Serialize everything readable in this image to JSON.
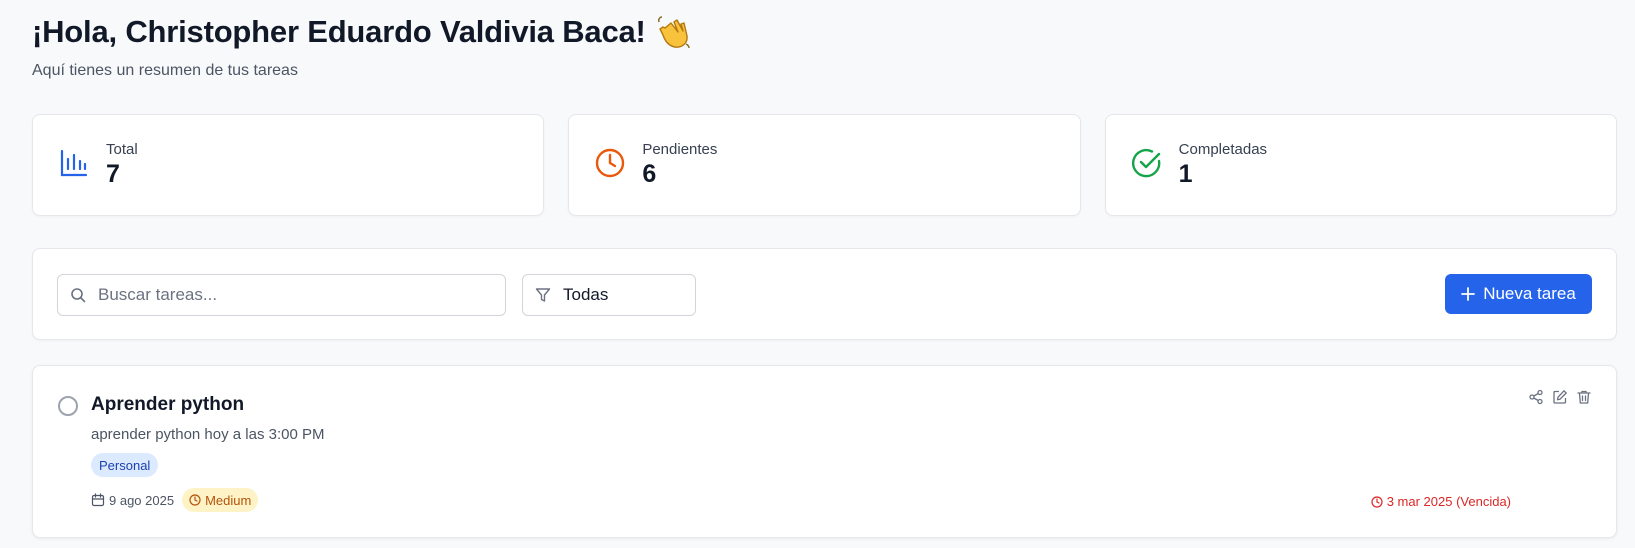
{
  "header": {
    "greeting": "¡Hola, Christopher Eduardo Valdivia Baca!",
    "wave_icon": "waving-hand-emoji",
    "subtitle": "Aquí tienes un resumen de tus tareas"
  },
  "stats": [
    {
      "label": "Total",
      "value": "7",
      "icon": "bar-chart-icon",
      "color": "#2563eb"
    },
    {
      "label": "Pendientes",
      "value": "6",
      "icon": "clock-icon",
      "color": "#ea580c"
    },
    {
      "label": "Completadas",
      "value": "1",
      "icon": "check-circle-icon",
      "color": "#16a34a"
    }
  ],
  "toolbar": {
    "search_placeholder": "Buscar tareas...",
    "filter_value": "Todas",
    "new_task_label": "Nueva tarea",
    "accent": "#2563eb"
  },
  "tasks": [
    {
      "title": "Aprender python",
      "description": "aprender python hoy a las 3:00 PM",
      "category": "Personal",
      "created": "9 ago 2025",
      "priority": "Medium",
      "due": "3 mar 2025 (Vencida)",
      "completed": false
    }
  ]
}
